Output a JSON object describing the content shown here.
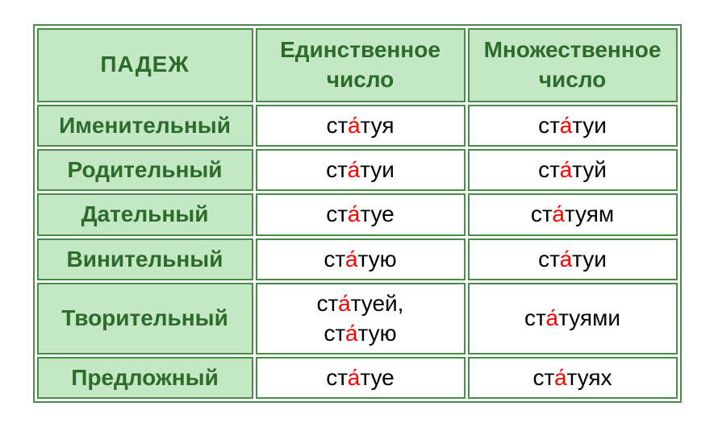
{
  "headers": {
    "case": "ПАДЕЖ",
    "singular_line1": "Единственное",
    "singular_line2": "число",
    "plural_line1": "Множественное",
    "plural_line2": "число"
  },
  "rows": [
    {
      "case": "Именительный",
      "singular": [
        {
          "pre": "ст",
          "stress": "а́",
          "post": "туя"
        }
      ],
      "plural": [
        {
          "pre": "ст",
          "stress": "а́",
          "post": "туи"
        }
      ]
    },
    {
      "case": "Родительный",
      "singular": [
        {
          "pre": "ст",
          "stress": "а́",
          "post": "туи"
        }
      ],
      "plural": [
        {
          "pre": "ст",
          "stress": "а́",
          "post": "туй"
        }
      ]
    },
    {
      "case": "Дательный",
      "singular": [
        {
          "pre": "ст",
          "stress": "а́",
          "post": "туе"
        }
      ],
      "plural": [
        {
          "pre": "ст",
          "stress": "а́",
          "post": "туям"
        }
      ]
    },
    {
      "case": "Винительный",
      "singular": [
        {
          "pre": "ст",
          "stress": "а́",
          "post": "тую"
        }
      ],
      "plural": [
        {
          "pre": "ст",
          "stress": "а́",
          "post": "туи"
        }
      ]
    },
    {
      "case": "Творительный",
      "singular": [
        {
          "pre": "ст",
          "stress": "а́",
          "post": "туей,"
        },
        {
          "pre": "ст",
          "stress": "а́",
          "post": "тую"
        }
      ],
      "plural": [
        {
          "pre": "ст",
          "stress": "а́",
          "post": "туями"
        }
      ]
    },
    {
      "case": "Предложный",
      "singular": [
        {
          "pre": "ст",
          "stress": "а́",
          "post": "туе"
        }
      ],
      "plural": [
        {
          "pre": "ст",
          "stress": "а́",
          "post": "туях"
        }
      ]
    }
  ]
}
